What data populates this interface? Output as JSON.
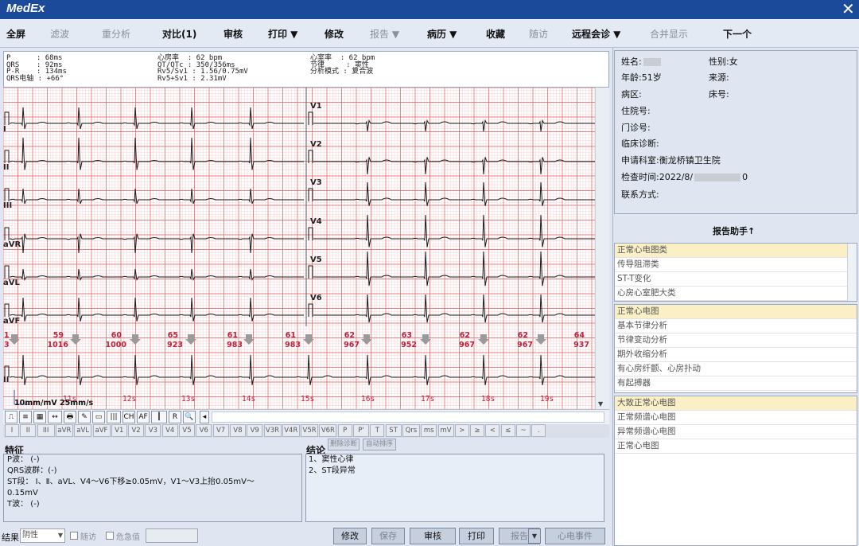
{
  "app": {
    "logo": "MedEx",
    "close": "✕"
  },
  "toolbar": [
    {
      "label": "全屏",
      "enabled": true
    },
    {
      "label": "滤波",
      "enabled": false
    },
    {
      "label": "重分析",
      "enabled": false
    },
    {
      "label": "对比(1)",
      "enabled": true
    },
    {
      "label": "审核",
      "enabled": true
    },
    {
      "label": "打印 ▼",
      "enabled": true
    },
    {
      "label": "修改",
      "enabled": true
    },
    {
      "label": "报告 ▼",
      "enabled": false
    },
    {
      "label": "病历 ▼",
      "enabled": true
    },
    {
      "label": "收藏",
      "enabled": true
    },
    {
      "label": "随访",
      "enabled": false
    },
    {
      "label": "远程会诊 ▼",
      "enabled": true
    },
    {
      "label": "合并显示",
      "enabled": false
    },
    {
      "label": "下一个",
      "enabled": true
    }
  ],
  "measurements": {
    "col1": [
      "P      : 68ms",
      "QRS    : 92ms",
      "P-R    : 134ms",
      "QRS电轴 : +66°"
    ],
    "col2": [
      "心房率  : 62 bpm",
      "QT/QTc : 350/356ms",
      "Rv5/Sv1 : 1.56/0.75mV",
      "Rv5+Sv1 : 2.31mV"
    ],
    "col3": [
      "心室率  : 62 bpm",
      "节律     : 窦性",
      "分析模式 : 复合波"
    ]
  },
  "ecg": {
    "leads_left": [
      "I",
      "II",
      "III",
      "aVR",
      "aVL",
      "aVF"
    ],
    "leads_right": [
      "V1",
      "V2",
      "V3",
      "V4",
      "V5",
      "V6"
    ],
    "rhythm_lead": "II",
    "beats": [
      {
        "hr": "59",
        "rr": "1016"
      },
      {
        "hr": "60",
        "rr": "1000"
      },
      {
        "hr": "65",
        "rr": "923"
      },
      {
        "hr": "61",
        "rr": "983"
      },
      {
        "hr": "61",
        "rr": "983"
      },
      {
        "hr": "62",
        "rr": "967"
      },
      {
        "hr": "63",
        "rr": "952"
      },
      {
        "hr": "62",
        "rr": "967"
      },
      {
        "hr": "62",
        "rr": "967"
      },
      {
        "hr": "64",
        "rr": "937"
      }
    ],
    "first_beat_label": "1",
    "first_beat_sub": "3",
    "time_ticks": [
      "11s",
      "12s",
      "13s",
      "14s",
      "15s",
      "16s",
      "17s",
      "18s",
      "19s"
    ],
    "calibration": "10mm/mV  25mm/s"
  },
  "tools": [
    "⎍",
    "≡",
    "▦",
    "↔",
    "🖶",
    "✎",
    "▭",
    "|||",
    "CH",
    "AF",
    "┃",
    "R",
    "🔍",
    "◂"
  ],
  "lead_buttons": [
    "I",
    "II",
    "III",
    "aVR",
    "aVL",
    "aVF",
    "V1",
    "V2",
    "V3",
    "V4",
    "V5",
    "V6",
    "V7",
    "V8",
    "V9",
    "V3R",
    "V4R",
    "V5R",
    "V6R",
    "P",
    "P'",
    "T",
    "ST",
    "Qrs",
    "ms",
    "mV",
    ">",
    "≥",
    "<",
    "≤",
    "~",
    "."
  ],
  "features": {
    "title": "特征",
    "lines": [
      "P波：     (-)",
      "QRS波群：(-)",
      "ST段：    Ⅰ、Ⅱ、aVL、V4～V6下移≥0.05mV，V1～V3上抬0.05mV～",
      "0.15mV",
      "T波：     (-)"
    ]
  },
  "conclusion": {
    "title": "结论",
    "btn_delete": "删除诊断",
    "btn_sort": "自动排序",
    "lines": [
      "1、窦性心律",
      "2、ST段异常"
    ]
  },
  "bottom": {
    "result_label": "结果",
    "result_value": "阴性",
    "followup": "随访",
    "critical": "危急值",
    "buttons": [
      "修改",
      "保存",
      "审核",
      "打印",
      "报告",
      "心电事件"
    ]
  },
  "patient": {
    "name_label": "姓名:",
    "gender": "性别:女",
    "age": "年龄:51岁",
    "source": "来源:",
    "ward": "病区:",
    "bed": "床号:",
    "inpatient": "住院号:",
    "outpatient": "门诊号:",
    "diagnosis": "临床诊断:",
    "dept": "申请科室:衡龙桥镇卫生院",
    "exam_time_prefix": "检查时间:2022/8/",
    "exam_time_suffix": "0",
    "contact": "联系方式:"
  },
  "helper": {
    "title": "报告助手↑",
    "categories": [
      "正常心电图类",
      "传导阻滞类",
      "ST-T变化",
      "心房心室肥大类"
    ],
    "analysis": [
      "正常心电图",
      "基本节律分析",
      "节律变动分析",
      "期外收缩分析",
      "有心房纤颤、心房扑动",
      "有起搏器"
    ],
    "terms": [
      "大致正常心电图",
      "正常频谱心电图",
      "异常频谱心电图",
      "正常心电图"
    ]
  },
  "colors": {
    "grid_minor": "#f6c6c6",
    "grid_major": "#e45a5a",
    "trace": "#1a1a1a",
    "accent": "#1b4a9b",
    "beat_label": "#c0203a"
  }
}
